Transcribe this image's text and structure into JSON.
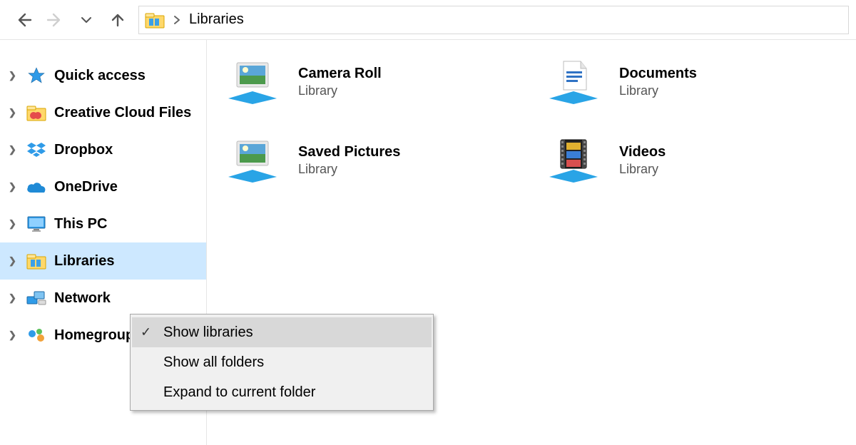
{
  "breadcrumb": {
    "location": "Libraries"
  },
  "sidebar": {
    "items": [
      {
        "label": "Quick access",
        "icon": "star-icon",
        "selected": false
      },
      {
        "label": "Creative Cloud Files",
        "icon": "cc-folder-icon",
        "selected": false
      },
      {
        "label": "Dropbox",
        "icon": "dropbox-icon",
        "selected": false
      },
      {
        "label": "OneDrive",
        "icon": "onedrive-icon",
        "selected": false
      },
      {
        "label": "This PC",
        "icon": "monitor-icon",
        "selected": false
      },
      {
        "label": "Libraries",
        "icon": "libraries-icon",
        "selected": true
      },
      {
        "label": "Network",
        "icon": "network-icon",
        "selected": false
      },
      {
        "label": "Homegroup",
        "icon": "homegroup-icon",
        "selected": false
      }
    ]
  },
  "content": {
    "subtype": "Library",
    "items": [
      {
        "title": "Camera Roll",
        "icon": "picture-library-icon"
      },
      {
        "title": "Documents",
        "icon": "document-library-icon"
      },
      {
        "title": "Saved Pictures",
        "icon": "picture-library-icon"
      },
      {
        "title": "Videos",
        "icon": "video-library-icon"
      }
    ]
  },
  "context_menu": {
    "items": [
      {
        "label": "Show libraries",
        "checked": true,
        "hover": true
      },
      {
        "label": "Show all folders",
        "checked": false,
        "hover": false
      },
      {
        "label": "Expand to current folder",
        "checked": false,
        "hover": false
      }
    ]
  }
}
